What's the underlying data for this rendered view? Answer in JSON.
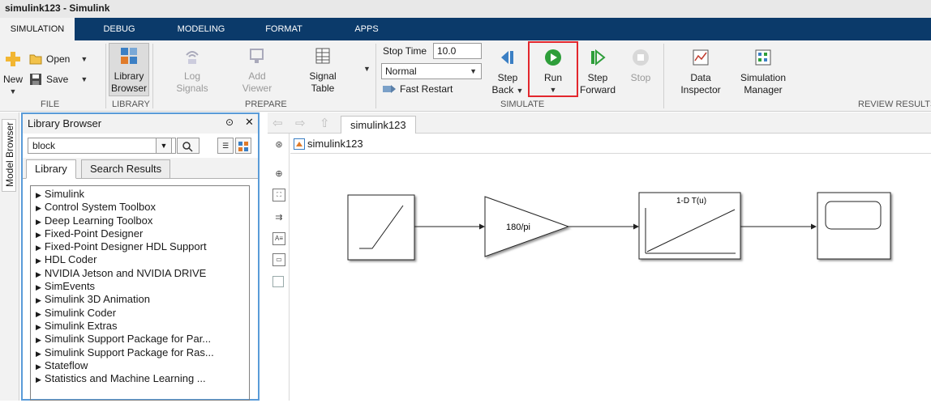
{
  "window": {
    "title": "simulink123 - Simulink"
  },
  "tabs": [
    "SIMULATION",
    "DEBUG",
    "MODELING",
    "FORMAT",
    "APPS"
  ],
  "ribbon": {
    "file": {
      "new": "New",
      "open": "Open",
      "save": "Save",
      "label": "FILE"
    },
    "library": {
      "button_line1": "Library",
      "button_line2": "Browser",
      "label": "LIBRARY"
    },
    "prepare": {
      "log_line1": "Log",
      "log_line2": "Signals",
      "add_line1": "Add",
      "add_line2": "Viewer",
      "table_line1": "Signal",
      "table_line2": "Table",
      "label": "PREPARE"
    },
    "simulate": {
      "stop_time_label": "Stop Time",
      "stop_time_value": "10.0",
      "mode_value": "Normal",
      "fast_restart": "Fast Restart",
      "step_back_line1": "Step",
      "step_back_line2": "Back",
      "run": "Run",
      "step_fwd_line1": "Step",
      "step_fwd_line2": "Forward",
      "stop": "Stop",
      "label": "SIMULATE"
    },
    "review": {
      "data_line1": "Data",
      "data_line2": "Inspector",
      "sim_line1": "Simulation",
      "sim_line2": "Manager",
      "label": "REVIEW RESULTS"
    }
  },
  "side_tab": "Model Browser",
  "library_browser": {
    "title": "Library Browser",
    "search_value": "block",
    "tabs": [
      "Library",
      "Search Results"
    ],
    "items": [
      "Simulink",
      "Control System Toolbox",
      "Deep Learning Toolbox",
      "Fixed-Point Designer",
      "Fixed-Point Designer HDL Support",
      "HDL Coder",
      "NVIDIA Jetson and NVIDIA DRIVE",
      "SimEvents",
      "Simulink 3D Animation",
      "Simulink Coder",
      "Simulink Extras",
      "Simulink Support Package for Par...",
      "Simulink Support Package for Ras...",
      "Stateflow",
      "Statistics and Machine Learning ..."
    ]
  },
  "model": {
    "tab": "simulink123",
    "breadcrumb": "simulink123",
    "gain_label": "180/pi",
    "lookup_label": "1-D T(u)"
  },
  "colors": {
    "tabbar": "#0b3a6a",
    "run_highlight": "#e3272d",
    "run_green": "#2e9e3a",
    "panel_border": "#5a9bd8"
  }
}
